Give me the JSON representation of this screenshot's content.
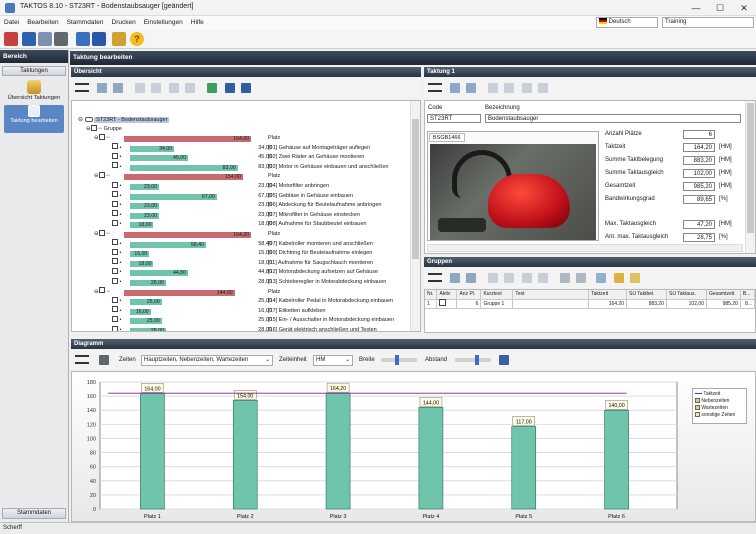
{
  "window": {
    "title": "TAKTOS 8.10 - ST23RT - Bodenstaubsauger [geändert]",
    "min": "—",
    "max": "☐",
    "close": "✕"
  },
  "menu": [
    "Datei",
    "Bearbeiten",
    "Stammdaten",
    "Drucken",
    "Einstellungen",
    "Hilfe"
  ],
  "top": {
    "language": "Deutsch",
    "profile": "Training"
  },
  "sidebar": {
    "title": "Bereich",
    "section": "Taktungen",
    "item1": "Übersicht Taktungen",
    "item2": "Taktung bearbeiten",
    "bottom": "Stammdaten"
  },
  "main_title": "Taktung bearbeiten",
  "overview": {
    "title": "Übersicht",
    "root": "ST23RT - Bodenstaubsauger",
    "group": "Gruppe",
    "rows": [
      {
        "type": "p",
        "val": "164,00",
        "txt": "Platz",
        "w": 0.62
      },
      {
        "type": "s",
        "val": "34,00",
        "txt": "[01] Gehäuse auf Montageträger auflegen",
        "w": 0.32
      },
      {
        "type": "s",
        "val": "45,00",
        "txt": "[02] Zwei Räder an Gehäuse montieren",
        "w": 0.42
      },
      {
        "type": "s",
        "val": "83,00",
        "txt": "[03] Motor in Gehäuse einbauen und anschließen",
        "w": 0.78
      },
      {
        "type": "p",
        "val": "154,00",
        "txt": "Platz",
        "w": 0.58
      },
      {
        "type": "s",
        "val": "23,00",
        "txt": "[04] Motorfilter anbringen",
        "w": 0.21
      },
      {
        "type": "s",
        "val": "67,00",
        "txt": "[05] Gebläse in Gehäuse einbauen",
        "w": 0.63
      },
      {
        "type": "s",
        "val": "23,00",
        "txt": "[06] Abdeckung für Beutelaufnahme anbringen",
        "w": 0.21
      },
      {
        "type": "s",
        "val": "23,00",
        "txt": "[07] Mikrofilter in Gehäuse einstecken",
        "w": 0.21
      },
      {
        "type": "s",
        "val": "18,00",
        "txt": "[08] Aufnahme für Staubbeutel einbauen",
        "w": 0.17
      },
      {
        "type": "p",
        "val": "164,20",
        "txt": "Platz",
        "w": 0.62
      },
      {
        "type": "s",
        "val": "58,40",
        "txt": "[07] Kabelroller montieren und anschließen",
        "w": 0.55
      },
      {
        "type": "s",
        "val": "15,00",
        "txt": "[09] Dichtring für Beutelaufnahme einlegen",
        "w": 0.14
      },
      {
        "type": "s",
        "val": "18,00",
        "txt": "[11] Aufnahme für Saugschlauch montieren",
        "w": 0.17
      },
      {
        "type": "s",
        "val": "44,80",
        "txt": "[12] Motorabdeckung aufsetzen auf Gehäuse",
        "w": 0.42
      },
      {
        "type": "s",
        "val": "28,00",
        "txt": "[13] Schiebereglier in Motorabdeckung einbauen",
        "w": 0.26
      },
      {
        "type": "p",
        "val": "144,00",
        "txt": "Platz",
        "w": 0.54
      },
      {
        "type": "s",
        "val": "25,00",
        "txt": "[14] Kabelroller Pedal in Motorabdeckung einbauen",
        "w": 0.23
      },
      {
        "type": "s",
        "val": "16,00",
        "txt": "[17] Etiketten aufkleben",
        "w": 0.15
      },
      {
        "type": "s",
        "val": "25,00",
        "txt": "[15] Ein- / Ausschalter in Motorabdeckung einbauen",
        "w": 0.23
      },
      {
        "type": "s",
        "val": "28,00",
        "txt": "[16] Gerät elektrisch anschließen und Testen",
        "w": 0.26
      }
    ]
  },
  "taktung": {
    "title": "Taktung 1",
    "code_label": "Code",
    "code": "ST23RT",
    "bez_label": "Bezeichnung",
    "bez": "Bodenstaubsauger",
    "image_tab": "BSGB1466",
    "stats": [
      {
        "label": "Anzahl Plätze",
        "value": "6",
        "unit": ""
      },
      {
        "label": "Taktzeit",
        "value": "164,20",
        "unit": "[HM]"
      },
      {
        "label": "Summe Taktbelegung",
        "value": "883,20",
        "unit": "[HM]"
      },
      {
        "label": "Summe Taktausgleich",
        "value": "102,00",
        "unit": "[HM]"
      },
      {
        "label": "Gesamtzeit",
        "value": "985,20",
        "unit": "[HM]"
      },
      {
        "label": "Bandwirkungsgrad",
        "value": "89,65",
        "unit": "[%]"
      },
      {
        "label": "Max. Taktausgleich",
        "value": "47,20",
        "unit": "[HM]"
      },
      {
        "label": "Ant. max. Taktausgleich",
        "value": "28,75",
        "unit": "[%]"
      }
    ]
  },
  "gruppen": {
    "title": "Gruppen",
    "headers": [
      "Nr.",
      "Aktiv",
      "Anz Pl.",
      "Kurztext",
      "Text",
      "Taktzeit",
      "SU Taktbel.",
      "SU Taktaus.",
      "Gesamtzeit",
      "B..."
    ],
    "row": [
      "1",
      "",
      "6",
      "Gruppe 1",
      "",
      "164,20",
      "883,20",
      "102,00",
      "985,20",
      "8..."
    ]
  },
  "diagramm": {
    "title": "Diagramm",
    "zeiten_label": "Zeiten",
    "zeiten": "Hauptzeiten, Nebenzeiten, Wartezeiten",
    "einheit_label": "Zeiteinheit",
    "einheit": "HM",
    "breite_label": "Breite",
    "abstand_label": "Abstand",
    "legend": [
      "Taktzeit",
      "Nebenzeiten",
      "Wartezeiten",
      "sonstige Zeiten"
    ]
  },
  "chart_data": {
    "type": "bar",
    "categories": [
      "Platz 1",
      "Platz 2",
      "Platz 3",
      "Platz 4",
      "Platz 5",
      "Platz 6"
    ],
    "values": [
      164,
      154,
      164.2,
      144,
      117,
      140
    ],
    "labels": [
      "164,00",
      "154,00",
      "164,20",
      "144,00",
      "117,00",
      "140,00"
    ],
    "taktzeit": 164.2,
    "ylim": [
      0,
      180
    ],
    "yticks": [
      0,
      20,
      40,
      60,
      80,
      100,
      120,
      140,
      160,
      180
    ],
    "colors": {
      "bar": "#70c4ac",
      "taktzeit": "#8a1c8a"
    }
  },
  "status": "Scherff"
}
